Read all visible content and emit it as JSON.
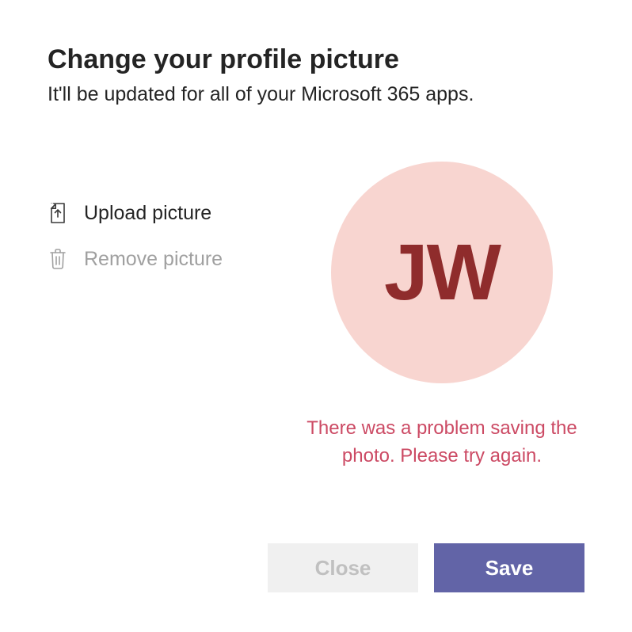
{
  "dialog": {
    "title": "Change your profile picture",
    "subtitle": "It'll be updated for all of your Microsoft 365 apps."
  },
  "actions": {
    "upload_label": "Upload picture",
    "remove_label": "Remove picture"
  },
  "avatar": {
    "initials": "JW",
    "bg_color": "#f8d5d0",
    "fg_color": "#8f2c2c"
  },
  "error": {
    "message": "There was a problem saving the photo. Please try again.",
    "color": "#cc4a64"
  },
  "buttons": {
    "close_label": "Close",
    "save_label": "Save",
    "primary_bg": "#6264a7"
  },
  "icons": {
    "upload_stroke": "#3a3a3a",
    "remove_stroke": "#a0a0a0"
  }
}
